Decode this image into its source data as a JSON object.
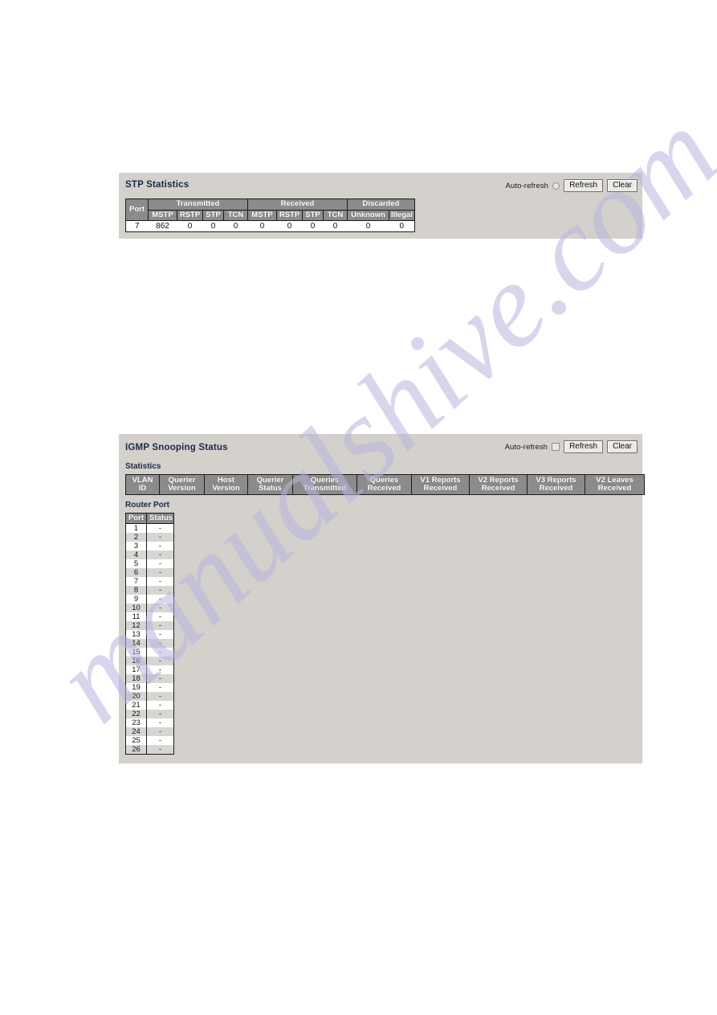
{
  "watermark": {
    "text": "manualshive.com"
  },
  "stp_panel": {
    "title": "STP Statistics",
    "toolbar": {
      "auto_refresh_label": "Auto-refresh",
      "refresh_label": "Refresh",
      "clear_label": "Clear"
    },
    "table": {
      "group_headers": [
        {
          "label": "Port",
          "span": 1,
          "rowspan": 2
        },
        {
          "label": "Transmitted",
          "span": 4
        },
        {
          "label": "Received",
          "span": 4
        },
        {
          "label": "Discarded",
          "span": 2
        }
      ],
      "sub_headers": [
        "MSTP",
        "RSTP",
        "STP",
        "TCN",
        "MSTP",
        "RSTP",
        "STP",
        "TCN",
        "Unknown",
        "Illegal"
      ],
      "rows": [
        [
          "7",
          "862",
          "0",
          "0",
          "0",
          "0",
          "0",
          "0",
          "0",
          "0",
          "0"
        ]
      ]
    }
  },
  "igmp_panel": {
    "title": "IGMP Snooping Status",
    "toolbar": {
      "auto_refresh_label": "Auto-refresh",
      "refresh_label": "Refresh",
      "clear_label": "Clear"
    },
    "statistics": {
      "section_label": "Statistics",
      "headers": [
        "VLAN\nID",
        "Querier\nVersion",
        "Host\nVersion",
        "Querier\nStatus",
        "Queries\nTransmitted",
        "Queries\nReceived",
        "V1 Reports\nReceived",
        "V2 Reports\nReceived",
        "V3 Reports\nReceived",
        "V2 Leaves\nReceived"
      ],
      "rows": []
    },
    "router_port": {
      "section_label": "Router Port",
      "headers": [
        "Port",
        "Status"
      ],
      "rows": [
        [
          "1",
          "-"
        ],
        [
          "2",
          "-"
        ],
        [
          "3",
          "-"
        ],
        [
          "4",
          "-"
        ],
        [
          "5",
          "-"
        ],
        [
          "6",
          "-"
        ],
        [
          "7",
          "-"
        ],
        [
          "8",
          "-"
        ],
        [
          "9",
          "-"
        ],
        [
          "10",
          "-"
        ],
        [
          "11",
          "-"
        ],
        [
          "12",
          "-"
        ],
        [
          "13",
          "-"
        ],
        [
          "14",
          "-"
        ],
        [
          "15",
          "-"
        ],
        [
          "16",
          "-"
        ],
        [
          "17",
          "-"
        ],
        [
          "18",
          "-"
        ],
        [
          "19",
          "-"
        ],
        [
          "20",
          "-"
        ],
        [
          "21",
          "-"
        ],
        [
          "22",
          "-"
        ],
        [
          "23",
          "-"
        ],
        [
          "24",
          "-"
        ],
        [
          "25",
          "-"
        ],
        [
          "26",
          "-"
        ]
      ]
    }
  },
  "colors": {
    "panel_bg": "#d4d0cb",
    "header_bg": "#8b8b8b",
    "header_text": "#ffffff",
    "title_text": "#1b2a4a",
    "watermark": "#b7b5e0",
    "alt_row": "#d8d6d2"
  }
}
